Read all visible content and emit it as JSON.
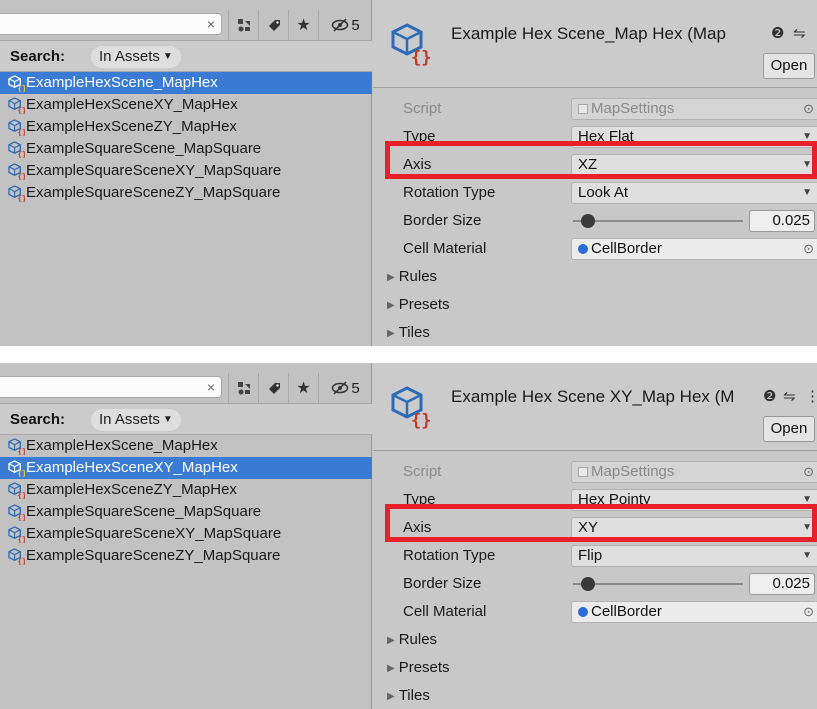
{
  "panels": [
    {
      "project": {
        "hidden_count": "5",
        "search_label": "Search:",
        "scope": "In Assets",
        "assets": [
          "ExampleHexScene_MapHex",
          "ExampleHexSceneXY_MapHex",
          "ExampleHexSceneZY_MapHex",
          "ExampleSquareScene_MapSquare",
          "ExampleSquareSceneXY_MapSquare",
          "ExampleSquareSceneZY_MapSquare"
        ],
        "selected_index": 0
      },
      "inspector": {
        "title": "Example Hex Scene_Map Hex (Map",
        "open_label": "Open",
        "script_label": "Script",
        "script_value": "MapSettings",
        "type_label": "Type",
        "type_value": "Hex Flat",
        "axis_label": "Axis",
        "axis_value": "XZ",
        "rotation_label": "Rotation Type",
        "rotation_value": "Look At",
        "border_label": "Border Size",
        "border_value": "0.025",
        "material_label": "Cell Material",
        "material_value": "CellBorder",
        "rules_label": "Rules",
        "presets_label": "Presets",
        "tiles_label": "Tiles"
      }
    },
    {
      "project": {
        "hidden_count": "5",
        "search_label": "Search:",
        "scope": "In Assets",
        "assets": [
          "ExampleHexScene_MapHex",
          "ExampleHexSceneXY_MapHex",
          "ExampleHexSceneZY_MapHex",
          "ExampleSquareScene_MapSquare",
          "ExampleSquareSceneXY_MapSquare",
          "ExampleSquareSceneZY_MapSquare"
        ],
        "selected_index": 1
      },
      "inspector": {
        "title": "Example Hex Scene XY_Map Hex (M",
        "open_label": "Open",
        "script_label": "Script",
        "script_value": "MapSettings",
        "type_label": "Type",
        "type_value": "Hex Pointy",
        "axis_label": "Axis",
        "axis_value": "XY",
        "rotation_label": "Rotation Type",
        "rotation_value": "Flip",
        "border_label": "Border Size",
        "border_value": "0.025",
        "material_label": "Cell Material",
        "material_value": "CellBorder",
        "rules_label": "Rules",
        "presets_label": "Presets",
        "tiles_label": "Tiles"
      }
    }
  ],
  "colors": {
    "highlight": "#e8202a",
    "selection": "#3a7bd5",
    "panel_bg": "#c8c8c8"
  },
  "icons": [
    "close-icon",
    "filter-type-icon",
    "label-tag-icon",
    "favorite-star-icon",
    "hidden-eye-icon",
    "scriptable-asset-icon",
    "help-icon",
    "settings-sliders-icon",
    "object-picker-icon",
    "dropdown-caret-icon",
    "foldout-triangle-icon"
  ]
}
